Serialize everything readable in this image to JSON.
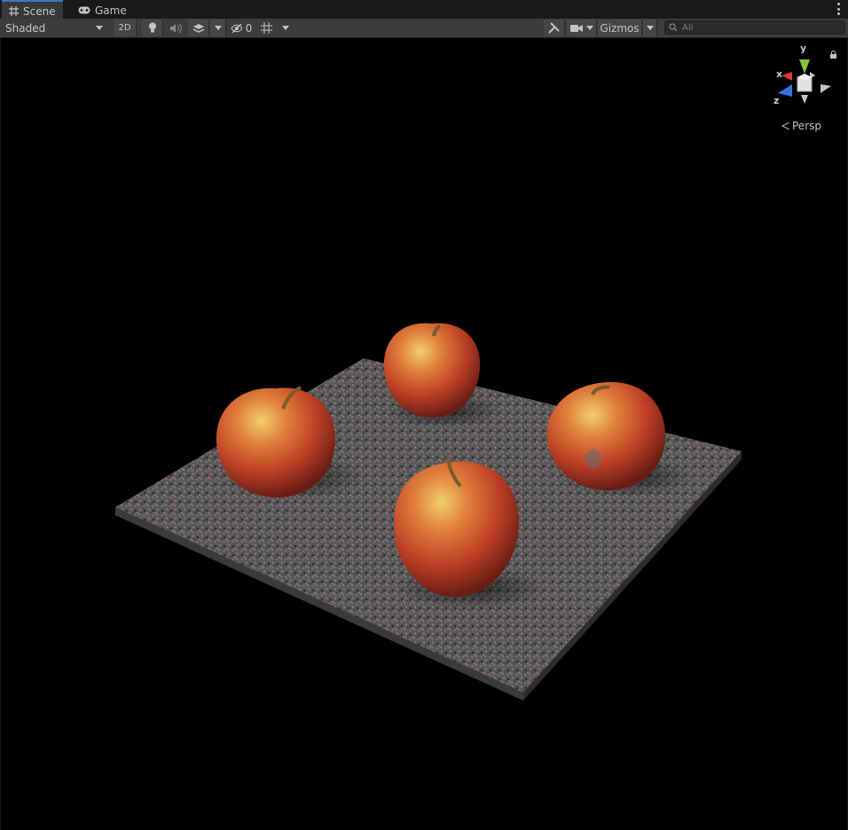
{
  "window": {
    "tabs": [
      {
        "label": "Scene",
        "icon": "hash-grid-icon",
        "active": true
      },
      {
        "label": "Game",
        "icon": "gamepad-icon",
        "active": false
      }
    ]
  },
  "toolbar": {
    "draw_mode": "Shaded",
    "mode_2d": "2D",
    "hidden_count": "0",
    "gizmos_label": "Gizmos",
    "search_placeholder": "All"
  },
  "scene_gizmo": {
    "axis_y": "y",
    "axis_x": "x",
    "axis_z": "z",
    "projection": "Persp",
    "colors": {
      "x": "#e0372a",
      "y": "#84c43a",
      "z": "#3a6fe0"
    }
  },
  "scene": {
    "objects": [
      "stone-slab",
      "apple",
      "apple",
      "apple",
      "apple"
    ],
    "colors": {
      "background": "#000000",
      "slab": "#5a5a5a",
      "apple": "#c0392b"
    }
  }
}
